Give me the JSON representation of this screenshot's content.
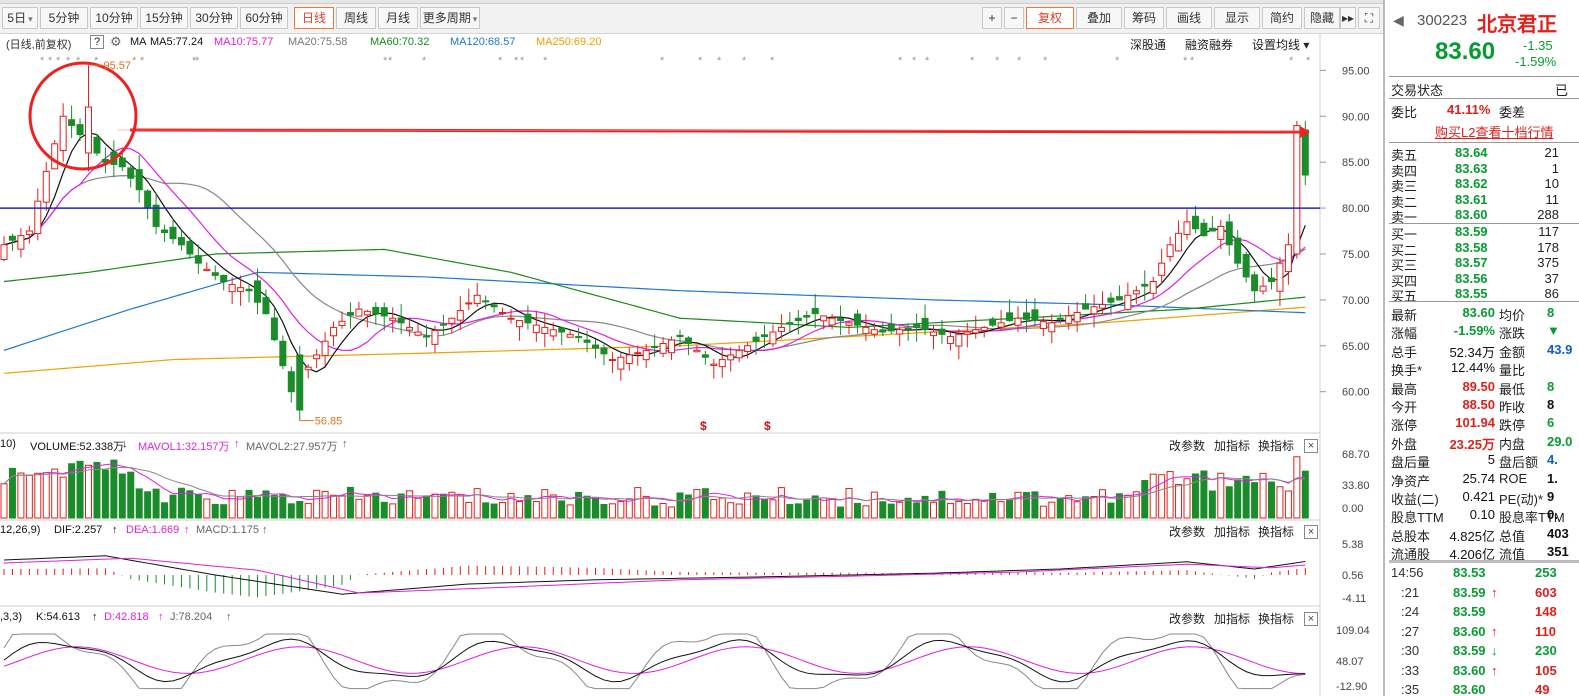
{
  "periods": [
    {
      "label": "5日",
      "arrow": "▾"
    },
    {
      "label": "5分钟"
    },
    {
      "label": "10分钟"
    },
    {
      "label": "15分钟"
    },
    {
      "label": "30分钟"
    },
    {
      "label": "60分钟"
    },
    {
      "label": "日线",
      "active": true
    },
    {
      "label": "周线"
    },
    {
      "label": "月线"
    },
    {
      "label": "更多周期",
      "arrow": "▾"
    }
  ],
  "toolbar": {
    "plus": "+",
    "minus": "−",
    "fuquan": "复权",
    "diejia": "叠加",
    "chouma": "筹码",
    "huaxian": "画线",
    "xianshi": "显示",
    "jianyue": "简约",
    "yincang": "隐藏",
    "more": "▸▸",
    "expand": "⛶"
  },
  "ma_info": {
    "mode": "(日线,前复权)",
    "help": "?",
    "ma": "MA",
    "ma5": "MA5:77.24",
    "ma10": "MA10:75.77",
    "ma20": "MA20:75.58",
    "ma60": "MA60:70.32",
    "ma120": "MA120:68.57",
    "ma250": "MA250:69.20"
  },
  "links": {
    "shengutong": "深股通",
    "rongzi": "融资融券",
    "shezhi": "设置均线 ▾"
  },
  "price_axis": [
    "95.00",
    "90.00",
    "85.00",
    "80.00",
    "75.00",
    "70.00",
    "65.00",
    "60.00"
  ],
  "annotations": {
    "high": "95.57",
    "low": "56.85",
    "s1": "$",
    "s2": "$"
  },
  "vol_info": {
    "prefix": "10)",
    "vol": "VOLUME:52.338万",
    "mavol1": "MAVOL1:32.157万",
    "mavol2": "MAVOL2:27.957万",
    "axis": [
      "68.70",
      "33.80",
      "0.00"
    ]
  },
  "macd_info": {
    "prefix": "12,26,9)",
    "dif": "DIF:2.257",
    "dea": "DEA:1.669",
    "macd": "MACD:1.175",
    "axis": [
      "5.38",
      "0.56",
      "-4.11"
    ]
  },
  "kdj_info": {
    "prefix": ",3,3)",
    "k": "K:54.613",
    "d": "D:42.818",
    "j": "J:78.204",
    "axis": [
      "109.04",
      "48.07",
      "-12.90"
    ]
  },
  "sub_buttons": {
    "gai": "改参数",
    "jia": "加指标",
    "huan": "换指标",
    "close": "×"
  },
  "quote": {
    "code": "300223",
    "name": "北京君正",
    "price": "83.60",
    "change": "-1.35",
    "pct": "-1.59%"
  },
  "trade_status": {
    "label": "交易状态",
    "value": "已"
  },
  "weibi": {
    "label": "委比",
    "value": "41.11%",
    "cha": "委差"
  },
  "l2_link": "购买L2查看十档行情",
  "asks": [
    {
      "l": "卖五",
      "p": "83.64",
      "v": "21"
    },
    {
      "l": "卖四",
      "p": "83.63",
      "v": "1"
    },
    {
      "l": "卖三",
      "p": "83.62",
      "v": "10"
    },
    {
      "l": "卖二",
      "p": "83.61",
      "v": "11"
    },
    {
      "l": "卖一",
      "p": "83.60",
      "v": "288"
    }
  ],
  "bids": [
    {
      "l": "买一",
      "p": "83.59",
      "v": "117"
    },
    {
      "l": "买二",
      "p": "83.58",
      "v": "178"
    },
    {
      "l": "买三",
      "p": "83.57",
      "v": "375"
    },
    {
      "l": "买四",
      "p": "83.56",
      "v": "37"
    },
    {
      "l": "买五",
      "p": "83.55",
      "v": "86"
    }
  ],
  "stats": [
    {
      "l1": "最新",
      "v1": "83.60",
      "c1": "green",
      "l2": "均价",
      "v2": "8",
      "c2": "green"
    },
    {
      "l1": "涨幅",
      "v1": "-1.59%",
      "c1": "green",
      "l2": "涨跌",
      "v2": "▼",
      "c2": "green"
    },
    {
      "l1": "总手",
      "v1": "52.34万",
      "c1": "blk",
      "l2": "金额",
      "v2": "43.9",
      "c2": "blue"
    },
    {
      "l1": "换手*",
      "v1": "12.44%",
      "c1": "blk",
      "l2": "量比",
      "v2": "",
      "c2": "blk"
    },
    {
      "l1": "最高",
      "v1": "89.50",
      "c1": "red",
      "l2": "最低",
      "v2": "8",
      "c2": "green"
    },
    {
      "l1": "今开",
      "v1": "88.50",
      "c1": "red",
      "l2": "昨收",
      "v2": "8",
      "c2": "blk"
    },
    {
      "l1": "涨停",
      "v1": "101.94",
      "c1": "red",
      "l2": "跌停",
      "v2": "6",
      "c2": "green"
    },
    {
      "l1": "外盘",
      "v1": "23.25万",
      "c1": "red",
      "l2": "内盘",
      "v2": "29.0",
      "c2": "green"
    },
    {
      "l1": "盘后量",
      "v1": "5",
      "c1": "blk",
      "l2": "盘后额",
      "v2": "4.",
      "c2": "blue"
    },
    {
      "l1": "净资产",
      "v1": "25.74",
      "c1": "blk",
      "l2": "ROE",
      "v2": "1.",
      "c2": "blk"
    },
    {
      "l1": "收益(二)",
      "v1": "0.421",
      "c1": "blk",
      "l2": "PE(动)*",
      "v2": "9",
      "c2": "blk"
    },
    {
      "l1": "股息TTM",
      "v1": "0.10",
      "c1": "blk",
      "l2": "股息率TTM",
      "v2": "0.",
      "c2": "blk"
    },
    {
      "l1": "总股本",
      "v1": "4.825亿",
      "c1": "blk",
      "l2": "总值",
      "v2": "403",
      "c2": "blk"
    },
    {
      "l1": "流通股",
      "v1": "4.206亿",
      "c1": "blk",
      "l2": "流值",
      "v2": "351",
      "c2": "blk"
    }
  ],
  "ticks": [
    {
      "t": "14:56",
      "p": "83.53",
      "a": "",
      "v": "253",
      "pc": "green",
      "vc": "green"
    },
    {
      "t": ":21",
      "p": "83.59",
      "a": "↑",
      "v": "603",
      "pc": "green",
      "vc": "red"
    },
    {
      "t": ":24",
      "p": "83.59",
      "a": "",
      "v": "148",
      "pc": "green",
      "vc": "red"
    },
    {
      "t": ":27",
      "p": "83.60",
      "a": "↑",
      "v": "110",
      "pc": "green",
      "vc": "red"
    },
    {
      "t": ":30",
      "p": "83.59",
      "a": "↓",
      "v": "230",
      "pc": "green",
      "vc": "green"
    },
    {
      "t": ":33",
      "p": "83.60",
      "a": "↑",
      "v": "105",
      "pc": "green",
      "vc": "red"
    },
    {
      "t": ":35",
      "p": "83.60",
      "a": "",
      "v": "49",
      "pc": "green",
      "vc": "red"
    }
  ],
  "colors": {
    "up": "#e0201b",
    "down": "#1a8c2a",
    "ma5": "#111111",
    "ma10": "#e020e0",
    "ma20": "#888888",
    "ma60": "#1a8a1a",
    "ma120": "#1f78d0",
    "ma250": "#f0a000"
  }
}
